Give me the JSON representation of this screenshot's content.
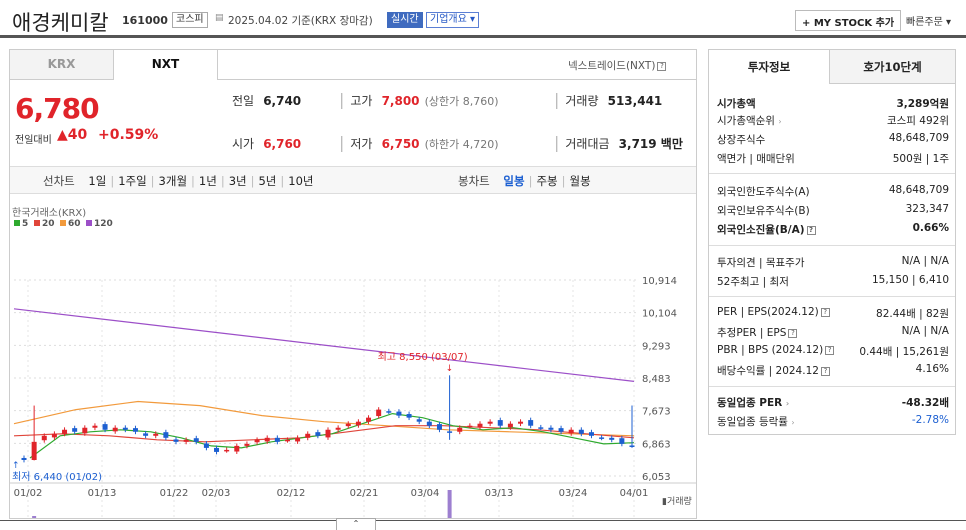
{
  "header": {
    "company": "애경케미칼",
    "code": "161000",
    "market": "코스피",
    "date_note": "2025.04.02 기준(KRX 장마감)",
    "realtime": "실시간",
    "overview": "기업개요",
    "mystock": "+ MY STOCK 추가",
    "quick_order": "빠른주문"
  },
  "exchange_tabs": [
    "KRX",
    "NXT"
  ],
  "selected_exchange": "NXT",
  "nxt_link": "넥스트레이드(NXT)",
  "price": {
    "current": "6,780",
    "change_label": "전일대비",
    "change": "▲40",
    "change_pct": "+0.59%",
    "prev_label": "전일",
    "prev": "6,740",
    "high_label": "고가",
    "high": "7,800",
    "upper_limit": "(상한가 8,760)",
    "volume_label": "거래량",
    "volume": "513,441",
    "open_label": "시가",
    "open": "6,760",
    "low_label": "저가",
    "low": "6,750",
    "lower_limit": "(하한가 4,720)",
    "amount_label": "거래대금",
    "amount": "3,719 백만"
  },
  "periods": {
    "line_label": "선차트",
    "line": [
      "1일",
      "1주일",
      "3개월",
      "1년",
      "3년",
      "5년",
      "10년"
    ],
    "candle_label": "봉차트",
    "candle": [
      "일봉",
      "주봉",
      "월봉"
    ],
    "selected_candle": "일봉"
  },
  "chart_data": {
    "type": "candlestick",
    "source": "한국거래소(KRX)",
    "legend": [
      {
        "name": "5",
        "color": "#2faa2f"
      },
      {
        "name": "20",
        "color": "#e0453a"
      },
      {
        "name": "60",
        "color": "#f29a3c"
      },
      {
        "name": "120",
        "color": "#9c4fc8"
      }
    ],
    "y_ticks": [
      "10,914",
      "10,104",
      "9,293",
      "8,483",
      "7,673",
      "6,863",
      "6,053"
    ],
    "x_ticks": [
      "01/02",
      "01/13",
      "01/22",
      "02/03",
      "02/12",
      "02/21",
      "03/04",
      "03/13",
      "03/24",
      "04/01"
    ],
    "volume_label": "거래량",
    "high_annotation": "최고 8,550 (03/07)",
    "low_annotation": "최저 6,440 (01/02)",
    "close_approx": [
      6450,
      6900,
      7050,
      7100,
      7200,
      7150,
      7250,
      7300,
      7200,
      7250,
      7200,
      7150,
      7050,
      7100,
      7000,
      6900,
      6950,
      6900,
      6750,
      6650,
      6700,
      6800,
      6850,
      6950,
      7000,
      6900,
      6950,
      7000,
      7100,
      7050,
      7200,
      7250,
      7350,
      7400,
      7500,
      7700,
      7650,
      7550,
      7500,
      7400,
      7300,
      7200,
      7150,
      7250,
      7300,
      7350,
      7400,
      7300,
      7350,
      7400,
      7300,
      7250,
      7200,
      7150,
      7200,
      7100,
      7050,
      7000,
      6950,
      6850,
      6780
    ],
    "ma5_approx": [
      6500,
      7050,
      7150,
      7200,
      7150,
      7000,
      6800,
      6750,
      6900,
      7000,
      7100,
      7350,
      7600,
      7500,
      7300,
      7200,
      7250,
      7150,
      7000,
      6850,
      6880
    ],
    "ma20_approx": [
      7050,
      7100,
      7050,
      6950,
      6900,
      6950,
      7000,
      7150,
      7300,
      7300,
      7250,
      7200,
      7100,
      7000
    ],
    "ma60_approx": [
      7350,
      7700,
      7900,
      7800,
      7550,
      7400,
      7300,
      7200,
      7150,
      7100,
      7050
    ],
    "ma120_approx": [
      10200,
      9900,
      9600,
      9300,
      9000,
      8700,
      8400
    ]
  },
  "right": {
    "tabs": [
      "투자정보",
      "호가10단계"
    ],
    "market_cap_label": "시가총액",
    "market_cap": "3,289억원",
    "rank_label": "시가총액순위",
    "rank": "코스피 492위",
    "shares_label": "상장주식수",
    "shares": "48,648,709",
    "par_label": "액면가 | 매매단위",
    "par": "500원 | 1주",
    "foreign_limit_label": "외국인한도주식수(A)",
    "foreign_limit": "48,648,709",
    "foreign_hold_label": "외국인보유주식수(B)",
    "foreign_hold": "323,347",
    "foreign_ratio_label": "외국인소진율(B/A)",
    "foreign_ratio": "0.66%",
    "opinion_label": "투자의견 | 목표주가",
    "opinion": "N/A | N/A",
    "w52_label": "52주최고 | 최저",
    "w52": "15,150 | 6,410",
    "per_label": "PER | EPS(2024.12)",
    "per": "82.44배 | 82원",
    "est_label": "추정PER | EPS",
    "est": "N/A | N/A",
    "pbr_label": "PBR | BPS (2024.12)",
    "pbr": "0.44배 | 15,261원",
    "div_label": "배당수익률 | 2024.12",
    "div": "4.16%",
    "ind_per_label": "동일업종 PER",
    "ind_per": "-48.32배",
    "ind_rate_label": "동일업종 등락률",
    "ind_rate": "-2.78%"
  }
}
